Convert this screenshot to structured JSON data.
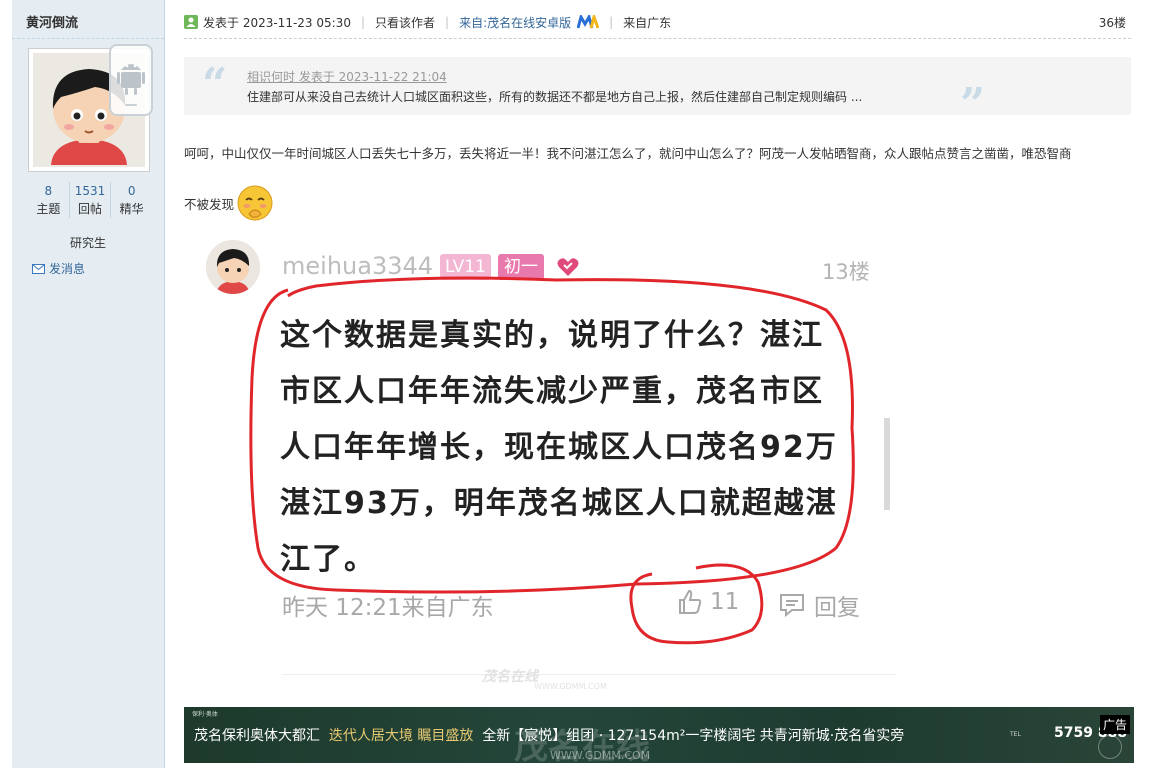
{
  "user": {
    "name": "黄河倒流",
    "stats": [
      {
        "num": "8",
        "label": "主题"
      },
      {
        "num": "1531",
        "label": "回帖"
      },
      {
        "num": "0",
        "label": "精华"
      }
    ],
    "rank": "研究生",
    "message_link": "发消息",
    "avatar_icon": "user-avatar-icon",
    "device_icon": "android-icon"
  },
  "post": {
    "posted_at": "发表于 2023-11-23 05:30",
    "only_author": "只看该作者",
    "source": "来自:茂名在线安卓版",
    "location": "来自广东",
    "floor": "36楼"
  },
  "quote": {
    "meta": "相识何时 发表于 2023-11-22 21:04",
    "text": "住建部可从来没自己去统计人口城区面积这些，所有的数据还不都是地方自己上报，然后住建部自己制定规则编码 ..."
  },
  "body": {
    "line1": "呵呵，中山仅仅一年时间城区人口丢失七十多万，丢失将近一半！我不问湛江怎么了，就问中山怎么了？阿茂一人发帖晒智商，众人跟帖点赞言之凿凿，唯恐智商",
    "line2": "不被发现",
    "emoji": "shy-face-emoji"
  },
  "embed": {
    "username": "meihua3344",
    "level": "LV11",
    "tag": "初一",
    "floor": "13楼",
    "comment": "这个数据是真实的，说明了什么？湛江市区人口年年流失减少严重，茂名市区人口年年增长，现在城区人口茂名92万湛江93万，明年茂名城区人口就超越湛江了。",
    "time": "昨天 12:21来自广东",
    "likes": "11",
    "reply": "回复",
    "watermark": "茂名在线",
    "watermark_url": "WWW.GDMM.COM",
    "annotation_color": "#e0262b"
  },
  "ad": {
    "brand_small": "保利·奥体",
    "text_part1": "茂名保利奥体大都汇",
    "text_gold": "迭代人居大境 瞩目盛放",
    "text_part2": "全新【宸悦】组团 · 127-154m²一字楼阔宅 共青河新城·茂名省实旁",
    "phone_prefix": "TEL",
    "phone": "5759 888",
    "label": "广告",
    "watermark": "茂名在线",
    "watermark_url": "WWW.GDMM.COM"
  },
  "colors": {
    "sidebar_bg": "#e5edf2",
    "link": "#336699",
    "quote_bg": "#f4f4f4"
  }
}
